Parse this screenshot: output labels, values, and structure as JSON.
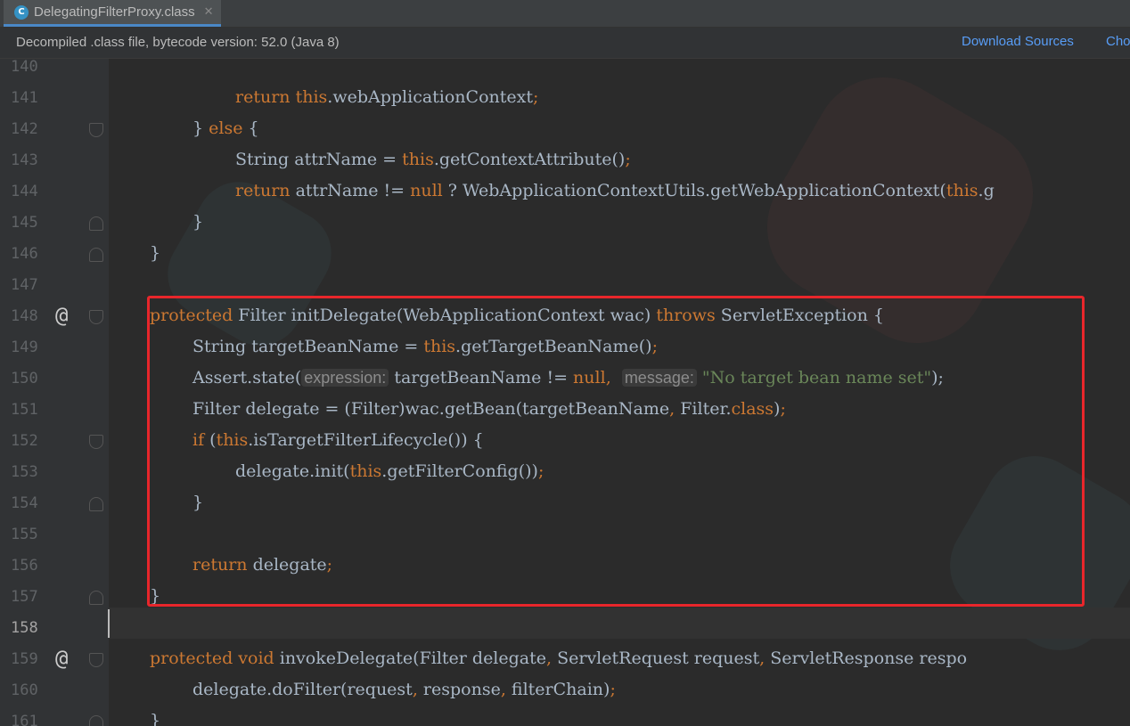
{
  "tab": {
    "title": "DelegatingFilterProxy.class",
    "icon": "class-file-icon",
    "close": "✕"
  },
  "banner": {
    "message": "Decompiled .class file, bytecode version: 52.0 (Java 8)",
    "download_sources": "Download Sources",
    "choose_sources": "Cho"
  },
  "colors": {
    "keyword": "#cc7832",
    "string": "#6a8759",
    "text": "#a9b7c6",
    "highlight_box": "#e8262b",
    "link": "#589df6"
  },
  "lines": [
    {
      "num": "140"
    },
    {
      "num": "141"
    },
    {
      "num": "142"
    },
    {
      "num": "143"
    },
    {
      "num": "144"
    },
    {
      "num": "145"
    },
    {
      "num": "146"
    },
    {
      "num": "147"
    },
    {
      "num": "148",
      "marker": "@"
    },
    {
      "num": "149"
    },
    {
      "num": "150"
    },
    {
      "num": "151"
    },
    {
      "num": "152"
    },
    {
      "num": "153"
    },
    {
      "num": "154"
    },
    {
      "num": "155"
    },
    {
      "num": "156"
    },
    {
      "num": "157"
    },
    {
      "num": "158"
    },
    {
      "num": "159",
      "marker": "@"
    },
    {
      "num": "160"
    },
    {
      "num": "161"
    }
  ],
  "code": {
    "l141": {
      "kw1": "return",
      "kw2": "this",
      "rest": ".webApplicationContext",
      "semi": ";"
    },
    "l142": {
      "brace": "} ",
      "kw": "else",
      "rest": " {"
    },
    "l143": {
      "a": "String attrName = ",
      "kw": "this",
      "b": ".getContextAttribute()",
      "semi": ";"
    },
    "l144": {
      "kw1": "return",
      "a": " attrName != ",
      "kw2": "null",
      "b": " ? WebApplicationContextUtils.getWebApplicationContext(",
      "kw3": "this",
      "c": ".g"
    },
    "l145": "}",
    "l146": "}",
    "l148": {
      "kw": "protected",
      "a": " Filter initDelegate(WebApplicationContext wac) ",
      "kw2": "throws",
      "b": " ServletException {"
    },
    "l149": {
      "a": "String targetBeanName = ",
      "kw": "this",
      "b": ".getTargetBeanName()",
      "semi": ";"
    },
    "l150": {
      "a": "Assert.state(",
      "hint1": "expression:",
      "b": " targetBeanName != ",
      "kw": "null",
      "comma": ",  ",
      "hint2": "message:",
      "str": " \"No target bean name set\"",
      "end": ");"
    },
    "l151": {
      "a": "Filter delegate = (Filter)wac.getBean(targetBeanName",
      "comma": ", ",
      "b": "Filter.",
      "kw": "class",
      "c": ")",
      "semi": ";"
    },
    "l152": {
      "kw": "if",
      "a": " (",
      "kw2": "this",
      "b": ".isTargetFilterLifecycle()) {"
    },
    "l153": {
      "a": "delegate.init(",
      "kw": "this",
      "b": ".getFilterConfig())",
      "semi": ";"
    },
    "l154": "}",
    "l156": {
      "kw": "return",
      "a": " delegate",
      "semi": ";"
    },
    "l157": "}",
    "l159": {
      "kw": "protected",
      "kw2": " void",
      "a": " invokeDelegate(Filter delegate",
      "c1": ", ",
      "b": "ServletRequest request",
      "c2": ", ",
      "c": "ServletResponse respo"
    },
    "l160": {
      "a": "delegate.doFilter(request",
      "c1": ", ",
      "b": "response",
      "c2": ", ",
      "c": "filterChain)",
      "semi": ";"
    },
    "l161": "}"
  }
}
